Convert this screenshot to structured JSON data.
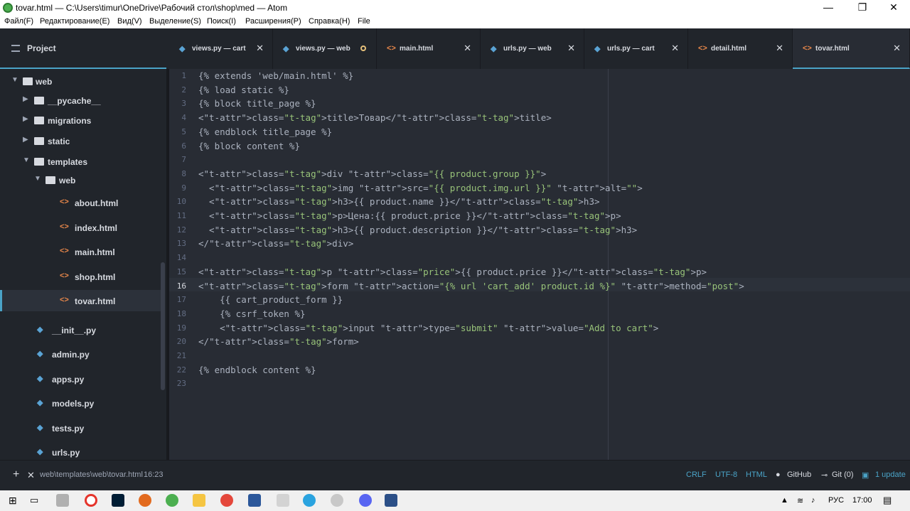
{
  "window": {
    "title": "tovar.html — C:\\Users\\timur\\OneDrive\\Рабочий стол\\shop\\med — Atom",
    "minimize": "—",
    "maximize": "❐",
    "close": "✕"
  },
  "menu": [
    "Файл(F)",
    "Редактирование(E)",
    "Вид(V)",
    "Выделение(S)",
    "Поиск(I)",
    "Расширения(P)",
    "Справка(H)",
    "File"
  ],
  "project_tab": "Project",
  "tabs": [
    {
      "label": "views.py — cart",
      "icon": "python-icon",
      "modified": false,
      "active": false
    },
    {
      "label": "views.py — web",
      "icon": "python-icon",
      "modified": true,
      "active": false
    },
    {
      "label": "main.html",
      "icon": "html-icon",
      "modified": false,
      "active": false
    },
    {
      "label": "urls.py — web",
      "icon": "python-icon",
      "modified": false,
      "active": false
    },
    {
      "label": "urls.py — cart",
      "icon": "python-icon",
      "modified": false,
      "active": false
    },
    {
      "label": "detail.html",
      "icon": "html-icon",
      "modified": false,
      "active": false
    },
    {
      "label": "tovar.html",
      "icon": "html-icon",
      "modified": false,
      "active": true
    }
  ],
  "tree": [
    {
      "label": "web",
      "type": "folder",
      "open": true
    },
    {
      "label": "__pycache__",
      "type": "folder",
      "open": false
    },
    {
      "label": "migrations",
      "type": "folder",
      "open": false
    },
    {
      "label": "static",
      "type": "folder",
      "open": false
    },
    {
      "label": "templates",
      "type": "folder",
      "open": true
    },
    {
      "label": "web",
      "type": "folder",
      "open": true
    },
    {
      "label": "about.html",
      "type": "html"
    },
    {
      "label": "index.html",
      "type": "html"
    },
    {
      "label": "main.html",
      "type": "html"
    },
    {
      "label": "shop.html",
      "type": "html"
    },
    {
      "label": "tovar.html",
      "type": "html",
      "selected": true
    },
    {
      "label": "__init__.py",
      "type": "python"
    },
    {
      "label": "admin.py",
      "type": "python"
    },
    {
      "label": "apps.py",
      "type": "python"
    },
    {
      "label": "models.py",
      "type": "python"
    },
    {
      "label": "tests.py",
      "type": "python"
    },
    {
      "label": "urls.py",
      "type": "python"
    }
  ],
  "editor": {
    "line_numbers": [
      "1",
      "2",
      "3",
      "4",
      "5",
      "6",
      "7",
      "8",
      "9",
      "10",
      "11",
      "12",
      "13",
      "14",
      "15",
      "16",
      "17",
      "18",
      "19",
      "20",
      "21",
      "22",
      "23"
    ],
    "current_line": 16,
    "lines": [
      "{% extends 'web/main.html' %}",
      "{% load static %}",
      "{% block title_page %}",
      "<title>Товар</title>",
      "{% endblock title_page %}",
      "{% block content %}",
      "",
      "<div class=\"{{ product.group }}\">",
      "  <img src=\"{{ product.img.url }}\" alt=\"\">",
      "  <h3>{{ product.name }}</h3>",
      "  <p>Цена:{{ product.price }}</p>",
      "  <h3>{{ product.description }}</h3>",
      "</div>",
      "",
      "<p class=\"price\">{{ product.price }}</p>",
      "<form action=\"{% url 'cart_add' product.id %}\" method=\"post\">",
      "    {{ cart_product_form }}",
      "    {% csrf_token %}",
      "    <input type=\"submit\" value=\"Add to cart\">",
      "</form>",
      "",
      "{% endblock content %}",
      ""
    ]
  },
  "status": {
    "add": "+",
    "close": "✕",
    "path": "web\\templates\\web\\tovar.html",
    "cursor": "16:23",
    "line_ending": "CRLF",
    "encoding": "UTF-8",
    "grammar": "HTML",
    "github": "GitHub",
    "git": "Git (0)",
    "update": "1 update"
  },
  "taskbar": {
    "lang": "РУС",
    "time": "17:00"
  },
  "colors": {
    "accent": "#4aa3c7",
    "html_icon": "#e8874a",
    "python_icon": "#5aa3d4"
  }
}
